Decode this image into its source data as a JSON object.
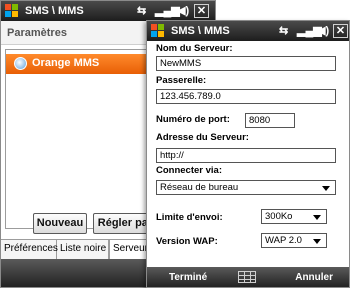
{
  "colors": {
    "selection": "#f26f12",
    "titlebar": "#2a2a2a"
  },
  "back": {
    "title": "SMS \\ MMS",
    "heading": "Paramètres",
    "list_items": [
      "Orange MMS"
    ],
    "buttons": {
      "new": "Nouveau",
      "set": "Régler par"
    },
    "tabs": [
      "Préférences",
      "Liste noire",
      "Serveurs"
    ],
    "active_tab": "Serveurs"
  },
  "front": {
    "title": "SMS \\ MMS",
    "server_name_label": "Nom du Serveur:",
    "server_name_value": "NewMMS",
    "gateway_label": "Passerelle:",
    "gateway_value": "123.456.789.0",
    "port_label": "Numéro de port:",
    "port_value": "8080",
    "server_address_label": "Adresse du Serveur:",
    "server_address_value": "http://",
    "connect_via_label": "Connecter via:",
    "connect_via_value": "Réseau de bureau",
    "send_limit_label": "Limite d'envoi:",
    "send_limit_value": "300Ko",
    "wap_version_label": "Version WAP:",
    "wap_version_value": "WAP 2.0",
    "softkeys": {
      "left": "Terminé",
      "right": "Annuler"
    }
  },
  "icons": {
    "windows_flag": "windows-logo-icon",
    "sync": "sync-icon",
    "signal": "signal-icon",
    "volume": "volume-icon",
    "close": "close-icon",
    "keyboard": "keyboard-icon"
  }
}
